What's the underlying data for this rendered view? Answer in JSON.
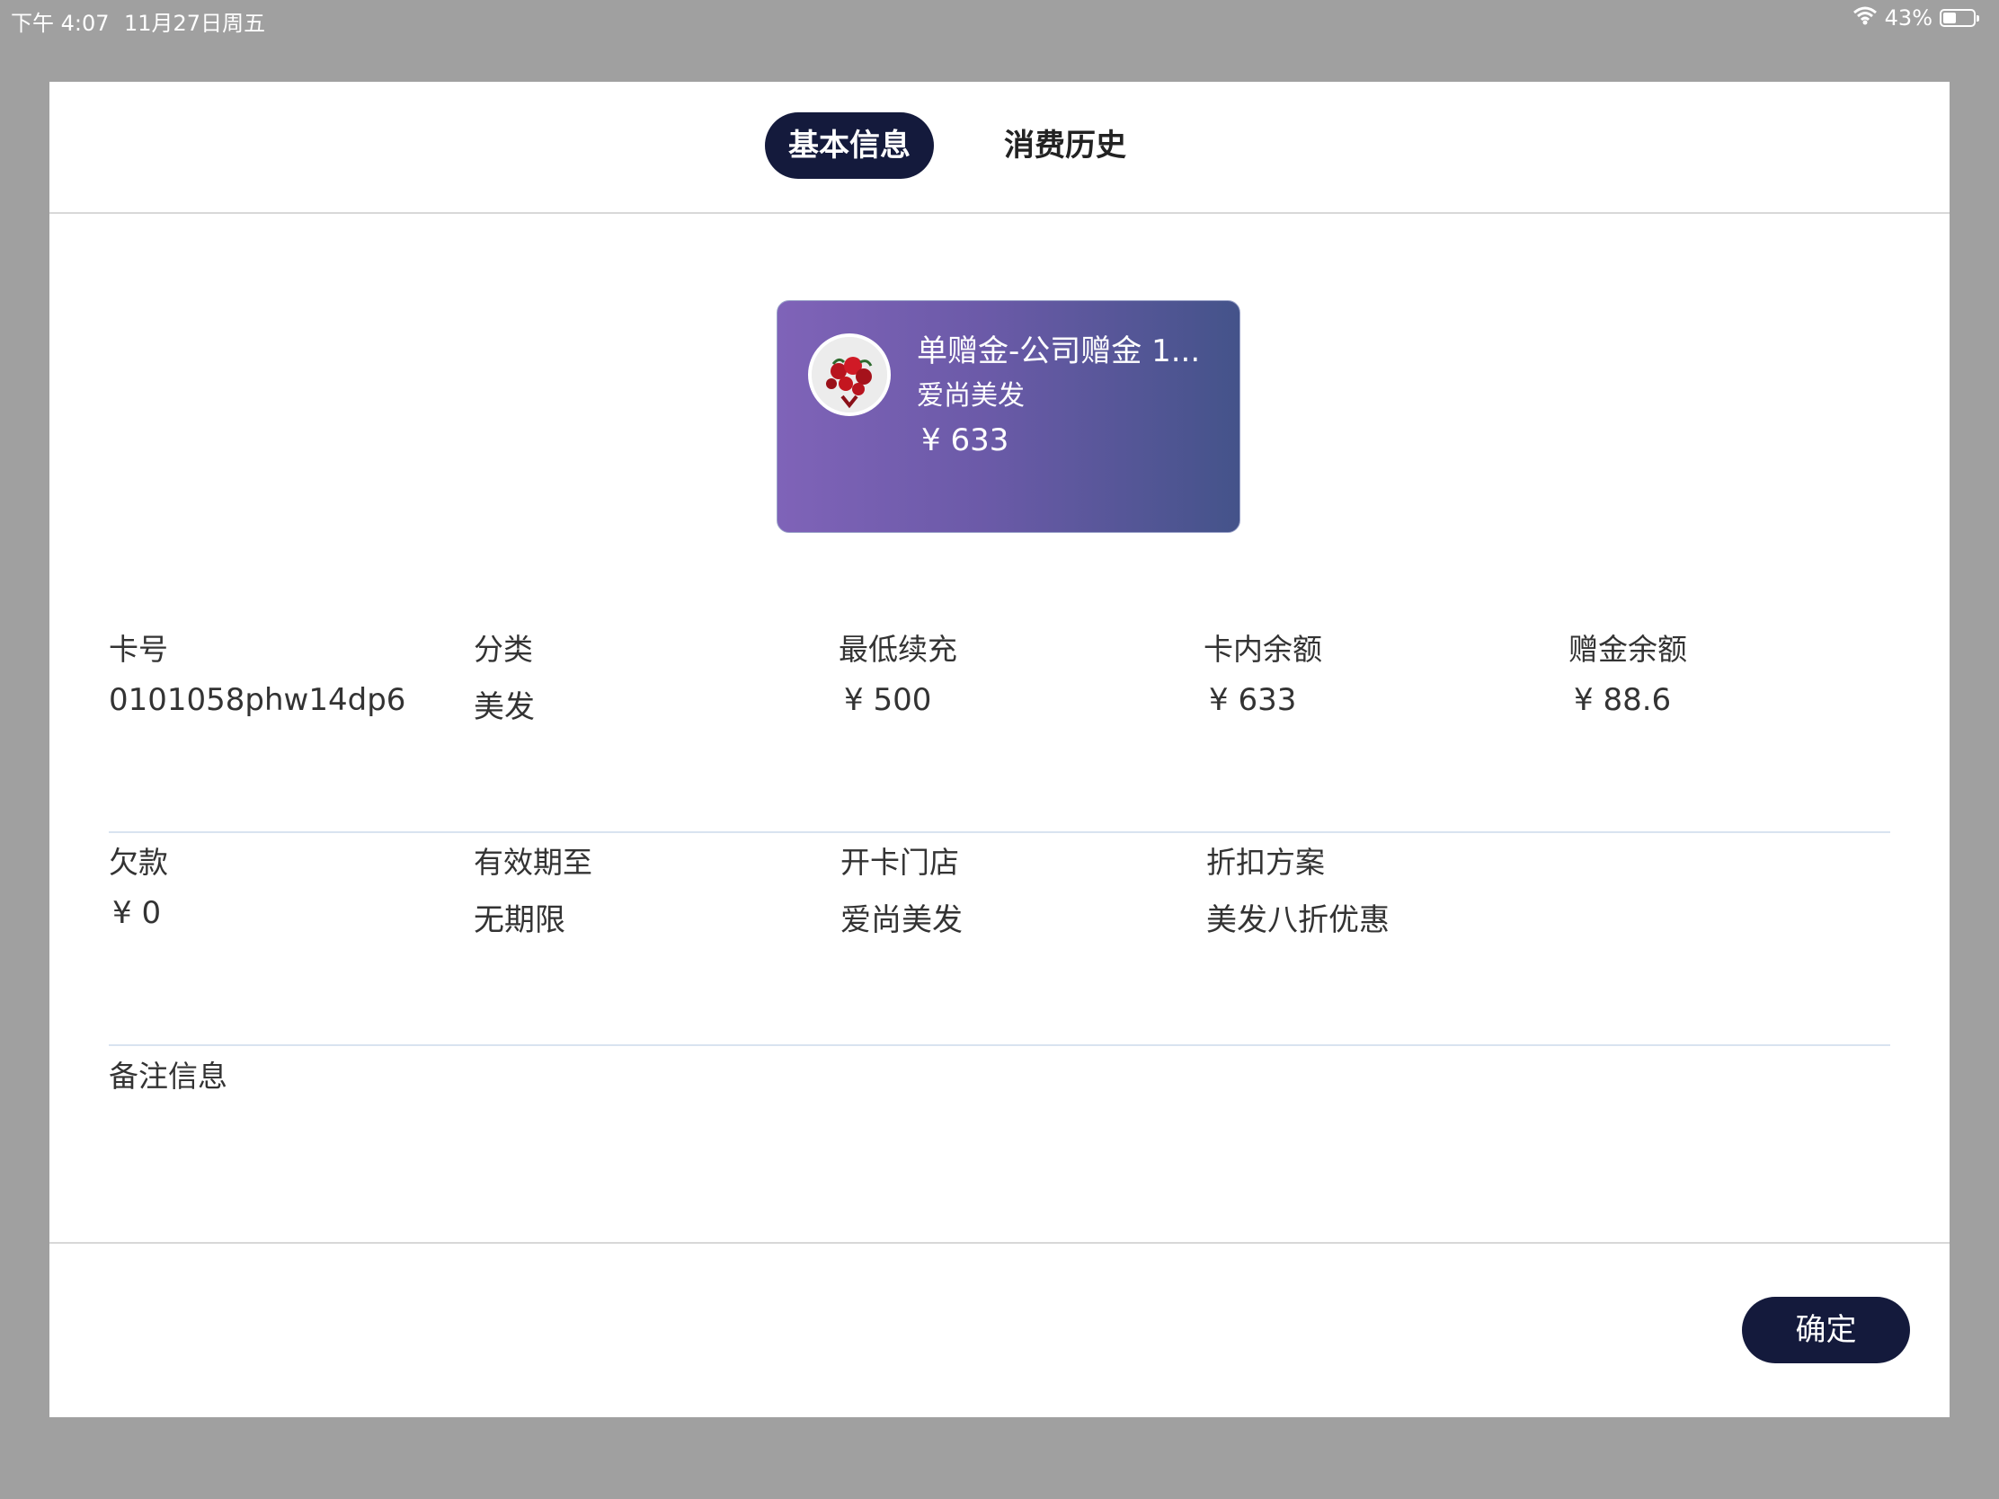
{
  "status_bar": {
    "time": "下午 4:07",
    "date": "11月27日周五",
    "battery": "43%",
    "battery_level": 0.43
  },
  "tabs": [
    {
      "label": "基本信息",
      "active": true
    },
    {
      "label": "消费历史",
      "active": false
    }
  ],
  "card": {
    "title": "单赠金-公司赠金 1...",
    "store": "爱尚美发",
    "amount": "¥ 633"
  },
  "info": {
    "row1": [
      {
        "label": "卡号",
        "value": "0101058phw14dp6"
      },
      {
        "label": "分类",
        "value": "美发"
      },
      {
        "label": "最低续充",
        "value": "¥ 500"
      },
      {
        "label": "卡内余额",
        "value": "¥ 633"
      },
      {
        "label": "赠金余额",
        "value": "¥ 88.6"
      }
    ],
    "row2": [
      {
        "label": "欠款",
        "value": "¥ 0"
      },
      {
        "label": "有效期至",
        "value": "无期限"
      },
      {
        "label": "开卡门店",
        "value": "爱尚美发"
      },
      {
        "label": "折扣方案",
        "value": "美发八折优惠"
      }
    ],
    "remark_label": "备注信息"
  },
  "footer": {
    "confirm_label": "确定"
  },
  "colors": {
    "primary": "#141a3c",
    "card_gradient_start": "#7f63b8",
    "card_gradient_end": "#44538a",
    "overlay": "#a0a0a0"
  }
}
